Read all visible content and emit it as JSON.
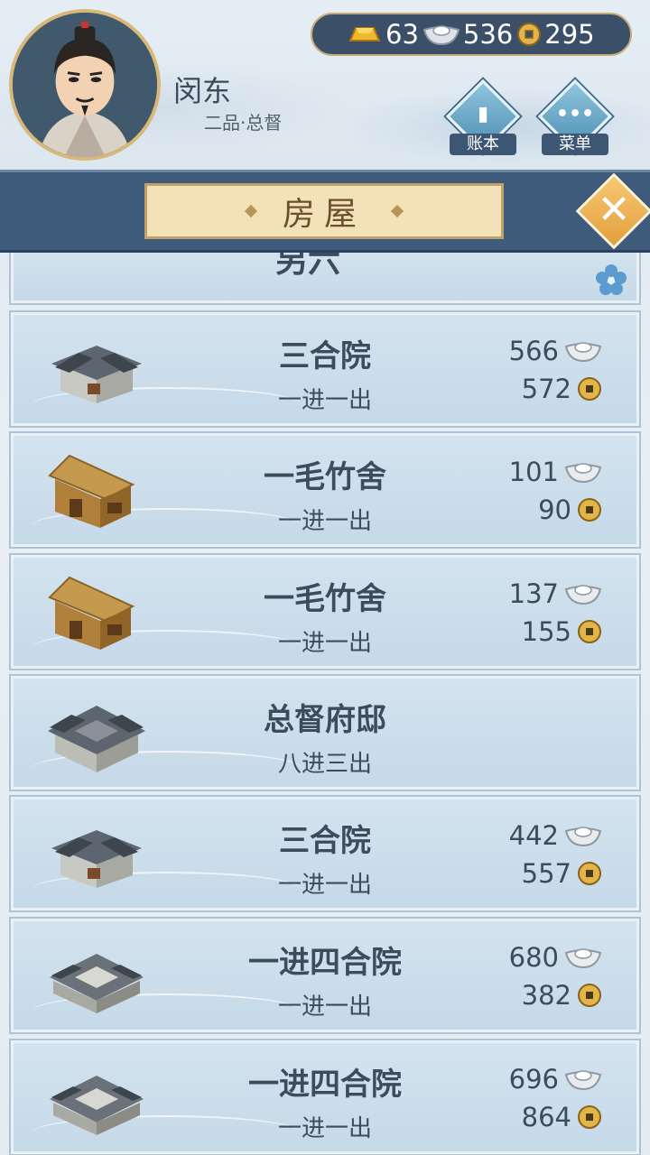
{
  "player": {
    "name": "闵东",
    "rank": "二品·总督"
  },
  "currency": {
    "gold": "63",
    "silver": "536",
    "coins": "295"
  },
  "buttons": {
    "ledger": "账本",
    "menu": "菜单"
  },
  "title": {
    "text": "房屋",
    "close_glyph": "✕"
  },
  "list": {
    "partial_item_name": "另六",
    "items": [
      {
        "name": "三合院",
        "layout": "一进一出",
        "silver": "566",
        "coins": "572",
        "icon": "courtyard-house-icon"
      },
      {
        "name": "一毛竹舍",
        "layout": "一进一出",
        "silver": "101",
        "coins": "90",
        "icon": "bamboo-hut-icon"
      },
      {
        "name": "一毛竹舍",
        "layout": "一进一出",
        "silver": "137",
        "coins": "155",
        "icon": "bamboo-hut-icon"
      },
      {
        "name": "总督府邸",
        "layout": "八进三出",
        "silver": "",
        "coins": "",
        "icon": "mansion-icon"
      },
      {
        "name": "三合院",
        "layout": "一进一出",
        "silver": "442",
        "coins": "557",
        "icon": "courtyard-house-icon"
      },
      {
        "name": "一进四合院",
        "layout": "一进一出",
        "silver": "680",
        "coins": "382",
        "icon": "siheyuan-icon"
      },
      {
        "name": "一进四合院",
        "layout": "一进一出",
        "silver": "696",
        "coins": "864",
        "icon": "siheyuan-icon"
      }
    ]
  },
  "colors": {
    "panel": "#c6d9e8",
    "banner": "#3f5b7c",
    "plaque": "#f3e2b8",
    "text": "#3d4c5d",
    "close": "#e3a03d"
  }
}
